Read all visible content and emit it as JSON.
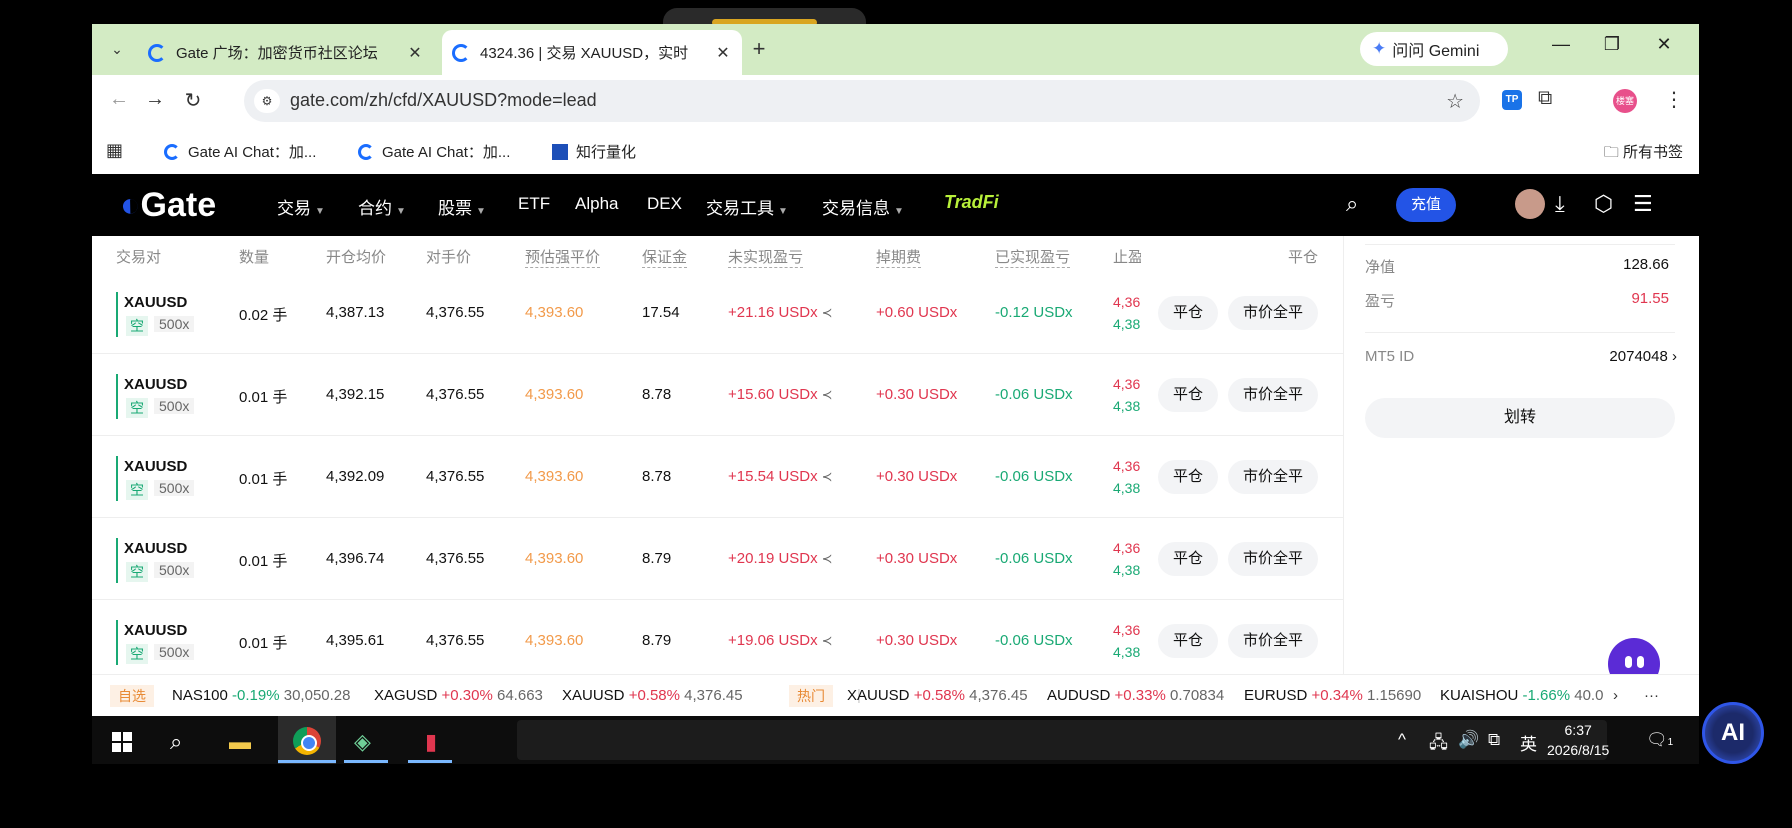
{
  "browser": {
    "tabs": [
      {
        "title": "Gate 广场：加密货币社区论坛",
        "active": false
      },
      {
        "title": "4324.36 | 交易 XAUUSD，实时",
        "active": true
      }
    ],
    "new_tab": "+",
    "gemini_label": "问问 Gemini",
    "url": "gate.com/zh/cfd/XAUUSD?mode=lead",
    "profile_label": "楼塞",
    "bookmarks": [
      {
        "label": "Gate AI Chat：加..."
      },
      {
        "label": "Gate AI Chat：加..."
      },
      {
        "label": "知行量化"
      }
    ],
    "all_bookmarks": "所有书签"
  },
  "site": {
    "logo": "Gate",
    "menu": [
      "交易",
      "合约",
      "股票",
      "ETF",
      "Alpha",
      "DEX",
      "交易工具",
      "交易信息"
    ],
    "tradfi": "TradFi",
    "deposit": "充值"
  },
  "table": {
    "headers": [
      "交易对",
      "数量",
      "开仓均价",
      "对手价",
      "预估强平价",
      "保证金",
      "未实现盈亏",
      "掉期费",
      "已实现盈亏",
      "止盈",
      "平仓"
    ],
    "rows": [
      {
        "symbol": "XAUUSD",
        "side": "空",
        "leverage": "500x",
        "qty": "0.02 手",
        "open": "4,387.13",
        "counter": "4,376.55",
        "liq": "4,393.60",
        "margin": "17.54",
        "upnl": "+21.16 USDx",
        "swap": "+0.60 USDx",
        "rpnl": "-0.12 USDx",
        "tp": "4,36",
        "sl": "4,38",
        "close": "平仓",
        "market_close": "市价全平"
      },
      {
        "symbol": "XAUUSD",
        "side": "空",
        "leverage": "500x",
        "qty": "0.01 手",
        "open": "4,392.15",
        "counter": "4,376.55",
        "liq": "4,393.60",
        "margin": "8.78",
        "upnl": "+15.60 USDx",
        "swap": "+0.30 USDx",
        "rpnl": "-0.06 USDx",
        "tp": "4,36",
        "sl": "4,38",
        "close": "平仓",
        "market_close": "市价全平"
      },
      {
        "symbol": "XAUUSD",
        "side": "空",
        "leverage": "500x",
        "qty": "0.01 手",
        "open": "4,392.09",
        "counter": "4,376.55",
        "liq": "4,393.60",
        "margin": "8.78",
        "upnl": "+15.54 USDx",
        "swap": "+0.30 USDx",
        "rpnl": "-0.06 USDx",
        "tp": "4,36",
        "sl": "4,38",
        "close": "平仓",
        "market_close": "市价全平"
      },
      {
        "symbol": "XAUUSD",
        "side": "空",
        "leverage": "500x",
        "qty": "0.01 手",
        "open": "4,396.74",
        "counter": "4,376.55",
        "liq": "4,393.60",
        "margin": "8.79",
        "upnl": "+20.19 USDx",
        "swap": "+0.30 USDx",
        "rpnl": "-0.06 USDx",
        "tp": "4,36",
        "sl": "4,38",
        "close": "平仓",
        "market_close": "市价全平"
      },
      {
        "symbol": "XAUUSD",
        "side": "空",
        "leverage": "500x",
        "qty": "0.01 手",
        "open": "4,395.61",
        "counter": "4,376.55",
        "liq": "4,393.60",
        "margin": "8.79",
        "upnl": "+19.06 USDx",
        "swap": "+0.30 USDx",
        "rpnl": "-0.06 USDx",
        "tp": "4,36",
        "sl": "4,38",
        "close": "平仓",
        "market_close": "市价全平"
      }
    ]
  },
  "account": {
    "equity_label": "净值",
    "equity": "128.66",
    "pnl_label": "盈亏",
    "pnl": "91.55",
    "mt5_label": "MT5 ID",
    "mt5_id": "2074048",
    "transfer": "划转"
  },
  "ticker": {
    "watch_tag": "自选",
    "hot_tag": "热门",
    "watch": [
      {
        "name": "NAS100",
        "change": "-0.19%",
        "price": "30,050.28"
      },
      {
        "name": "XAGUSD",
        "change": "+0.30%",
        "price": "64.663"
      },
      {
        "name": "XAUUSD",
        "change": "+0.58%",
        "price": "4,376.45"
      }
    ],
    "hot": [
      {
        "name": "XAUUSD",
        "change": "+0.58%",
        "price": "4,376.45"
      },
      {
        "name": "AUDUSD",
        "change": "+0.33%",
        "price": "0.70834"
      },
      {
        "name": "EURUSD",
        "change": "+0.34%",
        "price": "1.15690"
      },
      {
        "name": "KUAISHOU",
        "change": "-1.66%",
        "price": "40.0"
      }
    ],
    "more": "···"
  },
  "taskbar": {
    "ime": "英",
    "time": "6:37",
    "date": "2026/8/15",
    "notif_count": "1",
    "ai_label": "AI"
  }
}
